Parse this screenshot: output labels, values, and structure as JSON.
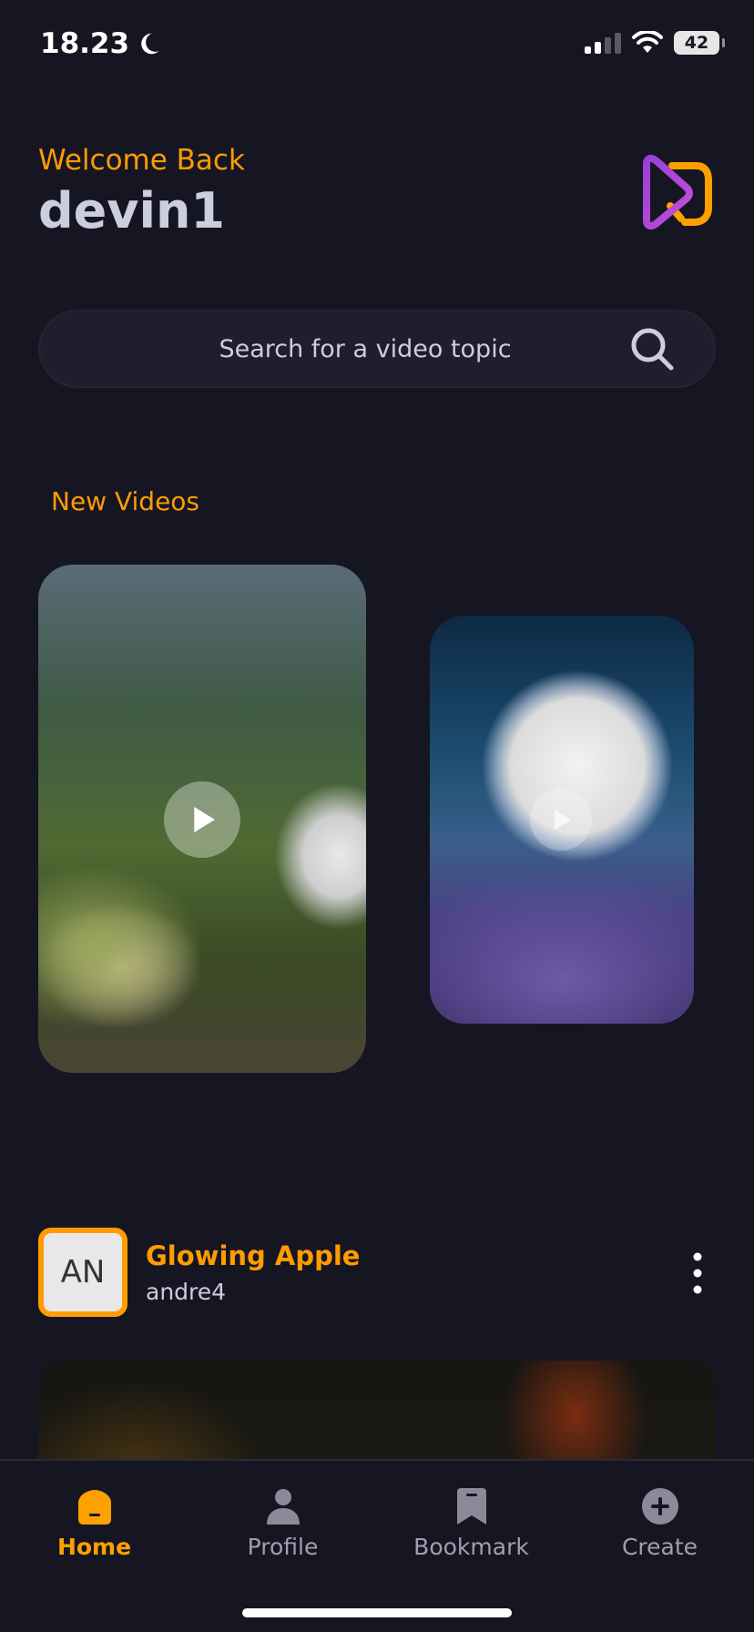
{
  "status_bar": {
    "time": "18.23",
    "battery": "42"
  },
  "header": {
    "welcome": "Welcome Back",
    "username": "devin1",
    "logo_icon": "app-logo-icon"
  },
  "search": {
    "placeholder": "Search for a video topic",
    "icon": "search-icon"
  },
  "new_videos": {
    "title": "New Videos"
  },
  "post": {
    "avatar_initials": "AN",
    "title": "Glowing Apple",
    "author": "andre4"
  },
  "tabs": [
    {
      "label": "Home",
      "icon": "home-icon",
      "active": true
    },
    {
      "label": "Profile",
      "icon": "profile-icon",
      "active": false
    },
    {
      "label": "Bookmark",
      "icon": "bookmark-icon",
      "active": false
    },
    {
      "label": "Create",
      "icon": "plus-circle-icon",
      "active": false
    }
  ],
  "colors": {
    "background": "#161622",
    "accent": "#FF9C01",
    "text_muted": "#CDCDE0"
  }
}
